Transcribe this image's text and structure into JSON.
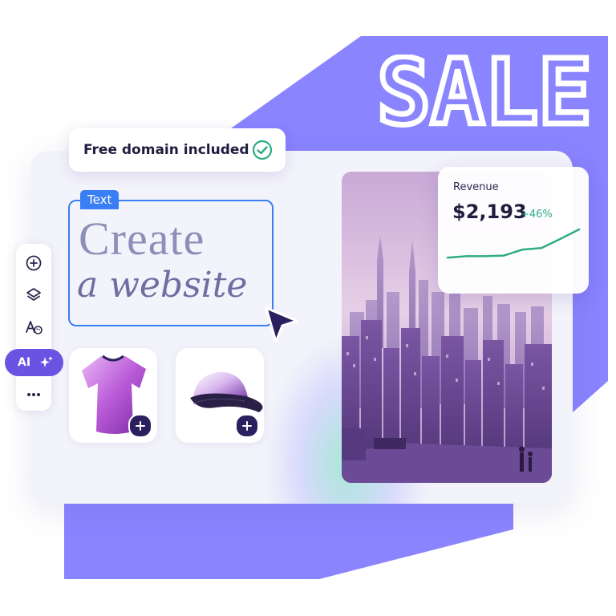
{
  "banner": {
    "sale_text": "SALE"
  },
  "domain_badge": {
    "label": "Free domain included",
    "icon": "check-circle-icon"
  },
  "text_element": {
    "tag": "Text",
    "line1": "Create",
    "line2": "a website"
  },
  "toolbar": {
    "items": [
      {
        "icon": "add-circle-icon"
      },
      {
        "icon": "layers-icon"
      },
      {
        "icon": "font-palette-icon"
      }
    ],
    "ai_label": "AI",
    "more_icon": "more-dots-icon"
  },
  "products": [
    {
      "name": "t-shirt",
      "icon": "plus-icon"
    },
    {
      "name": "cap",
      "icon": "plus-icon"
    }
  ],
  "revenue": {
    "label": "Revenue",
    "value": "$2,193",
    "delta": "+46%",
    "trend": [
      0.2,
      0.24,
      0.24,
      0.26,
      0.43,
      0.47,
      0.73,
      1.0
    ]
  },
  "colors": {
    "brand_purple": "#8a84ff",
    "accent": "#6a52e3",
    "selection_blue": "#3a7ef3",
    "positive_green": "#2eab84"
  }
}
